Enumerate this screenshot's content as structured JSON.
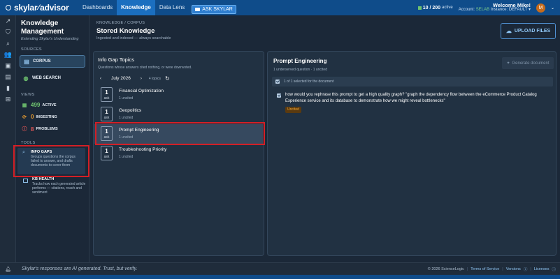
{
  "app": {
    "logo_text": "skylar",
    "logo_text2": "advisor"
  },
  "nav": {
    "items": [
      "Dashboards",
      "Knowledge",
      "Data Lens"
    ],
    "active": "Knowledge",
    "ask_label": "ASK SKYLAR"
  },
  "header": {
    "usage_count": "10 / 200",
    "usage_label": "active",
    "welcome": "Welcome Mike!",
    "account_label": "Account:",
    "account_value": "SELAB",
    "instance_label": "Instance:",
    "instance_value": "DEFAULT",
    "avatar_initial": "M"
  },
  "left_panel": {
    "title": "Knowledge Management",
    "subtitle": "Extending Skylar's Understanding",
    "sources_label": "SOURCES",
    "corpus_label": "CORPUS",
    "web_search_label": "WEB SEARCH",
    "views_label": "VIEWS",
    "stats": [
      {
        "value": "499",
        "label": "ACTIVE",
        "color": "#6fc36f"
      },
      {
        "value": "0",
        "label": "INGESTING",
        "color": "#f0a030"
      },
      {
        "value": "8",
        "label": "PROBLEMS",
        "color": "#e05555"
      }
    ],
    "tools_label": "TOOLS",
    "tools": [
      {
        "title": "INFO GAPS",
        "desc": "Groups questions the corpus failed to answer, and drafts documents to cover them"
      },
      {
        "title": "KB HEALTH",
        "desc": "Tracks how each generated article performs — citations, reach and sentiment"
      }
    ]
  },
  "main": {
    "breadcrumb": "KNOWLEDGE / CORPUS",
    "title": "Stored Knowledge",
    "subtitle": "Ingested and indexed — always searchable",
    "upload_label": "UPLOAD FILES"
  },
  "topics_card": {
    "title": "Info Gap Topics",
    "subtitle": "Questions whose answers cited nothing, or were downvoted.",
    "month": "July 2026",
    "count_label": "4 topics",
    "topics": [
      {
        "count": "1",
        "unit": "ask",
        "name": "Financial Optimization",
        "status": "1 uncited"
      },
      {
        "count": "1",
        "unit": "ask",
        "name": "Geopolitics",
        "status": "1 uncited"
      },
      {
        "count": "1",
        "unit": "ask",
        "name": "Prompt Engineering",
        "status": "1 uncited"
      },
      {
        "count": "1",
        "unit": "ask",
        "name": "Troubleshooting Priority",
        "status": "1 uncited"
      }
    ],
    "selected_index": 2
  },
  "detail_card": {
    "title": "Prompt Engineering",
    "subtitle": "1 underserved question · 1 uncited",
    "generate_label": "Generate document",
    "selection_text": "1 of 1 selected for the document",
    "question": "how would you rephrase this prompt to get a high quality graph? \"graph the dependency flow between the eCommerce Product Catalog Experience service and its database to demonstrate how we might reveal bottlenecks\"",
    "question_tag": "Uncited"
  },
  "footer": {
    "disclaimer": "Skylar's responses are AI generated. Trust, but verify.",
    "copyright": "© 2026 ScienceLogic",
    "terms": "Terms of Service",
    "versions": "Versions",
    "licenses": "Licenses"
  },
  "colors": {
    "topbar": "#0f4c8a",
    "nav_active": "#1b6fc0",
    "background": "#1b2838",
    "card": "#213142",
    "highlight_red": "#d41f26",
    "uncited_tag": "#f1a534"
  }
}
